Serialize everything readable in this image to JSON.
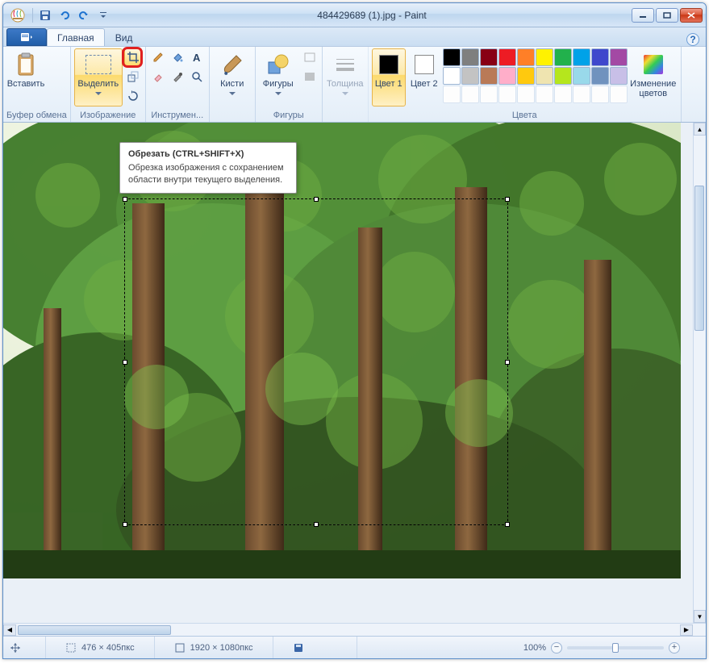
{
  "window": {
    "title": "484429689 (1).jpg - Paint"
  },
  "tabs": {
    "file": "",
    "home": "Главная",
    "view": "Вид"
  },
  "ribbon": {
    "clipboard": {
      "label": "Буфер обмена",
      "paste": "Вставить"
    },
    "image": {
      "label": "Изображение",
      "select": "Выделить",
      "crop": "Обрезать",
      "resize": "Изменить размер",
      "rotate": "Повернуть"
    },
    "tools": {
      "label": "Инструмен..."
    },
    "brushes": {
      "label": "Кисти",
      "btn": "Кисти"
    },
    "shapes": {
      "label": "Фигуры",
      "btn": "Фигуры",
      "outline": "Контур",
      "fill": "Заливка"
    },
    "thickness": {
      "label": "Толщина",
      "btn": "Толщина"
    },
    "colors": {
      "label": "Цвета",
      "c1": "Цвет 1",
      "c2": "Цвет 2",
      "edit": "Изменение цветов",
      "c1_hex": "#000000",
      "c2_hex": "#ffffff",
      "row1": [
        "#000000",
        "#7f7f7f",
        "#880015",
        "#ed1c24",
        "#ff7f27",
        "#fff200",
        "#22b14c",
        "#00a2e8",
        "#3f48cc",
        "#a349a4"
      ],
      "row2": [
        "#ffffff",
        "#c3c3c3",
        "#b97a57",
        "#ffaec9",
        "#ffc90e",
        "#efe4b0",
        "#b5e61d",
        "#99d9ea",
        "#7092be",
        "#c8bfe7"
      ]
    }
  },
  "tooltip": {
    "title": "Обрезать (CTRL+SHIFT+X)",
    "body": "Обрезка изображения с сохранением области внутри текущего выделения."
  },
  "statusbar": {
    "pos": "",
    "sel": "476 × 405пкс",
    "size": "1920 × 1080пкс",
    "filesize": "",
    "zoom": "100%"
  }
}
